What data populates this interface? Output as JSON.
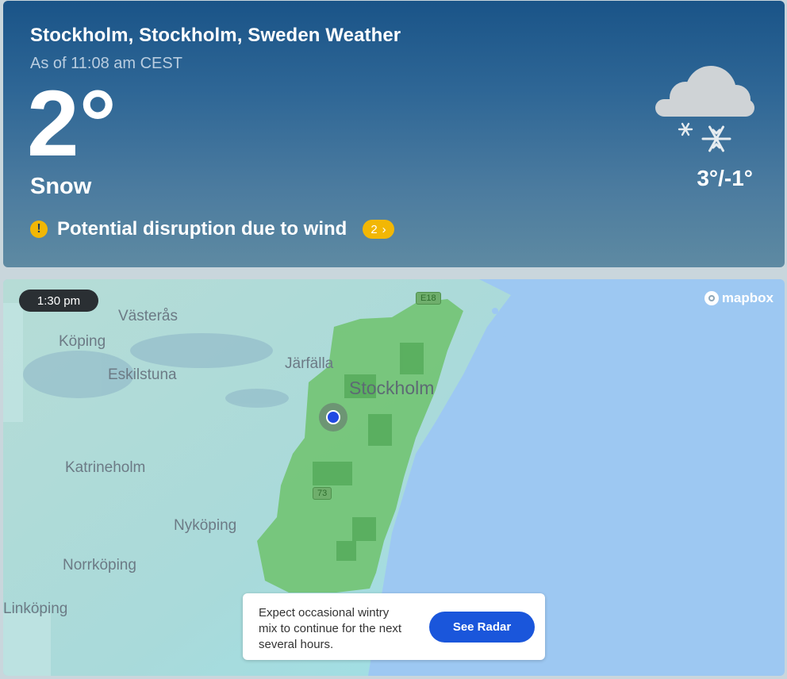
{
  "header": {
    "location_title": "Stockholm, Stockholm, Sweden Weather",
    "as_of": "As of 11:08 am CEST",
    "temperature": "2°",
    "condition": "Snow",
    "hi_lo": "3°/-1°",
    "icon": "snow-cloud-icon"
  },
  "alert": {
    "icon": "exclamation-icon",
    "text": "Potential disruption due to wind",
    "count": "2",
    "chevron": "›"
  },
  "map": {
    "time": "1:30 pm",
    "attribution": "mapbox",
    "places": {
      "vasteras": "Västerås",
      "koping": "Köping",
      "eskilstuna": "Eskilstuna",
      "jarfalla": "Järfälla",
      "stockholm": "Stockholm",
      "katrineholm": "Katrineholm",
      "nykoping": "Nyköping",
      "norrkoping": "Norrköping",
      "linkoping": "Linköping"
    },
    "roads": {
      "e18": "E18",
      "r73": "73"
    }
  },
  "radar_card": {
    "message": "Expect occasional wintry mix to continue for the next several hours.",
    "button": "See Radar"
  },
  "colors": {
    "card_top": "#1a5488",
    "alert_yellow": "#f2b705",
    "radar_button": "#1a56db",
    "sea": "#9dc8f2",
    "land": "#a9dcdb",
    "precip": "#6fc26c"
  }
}
